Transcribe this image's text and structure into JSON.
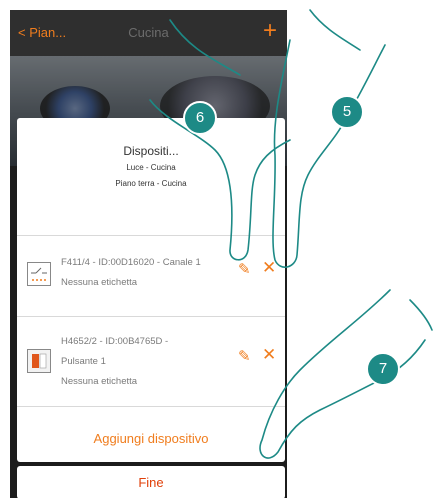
{
  "topbar": {
    "back_label": "Pian...",
    "title": "Cucina",
    "plus_icon": "+"
  },
  "card": {
    "title": "Dispositi...",
    "subtitle1": "Luce - Cucina",
    "subtitle2": "Piano terra - Cucina",
    "devices": [
      {
        "line1": "F411/4 - ID:00D16020 - Canale 1",
        "line2": "Nessuna etichetta",
        "line3": ""
      },
      {
        "line1": "H4652/2 - ID:00B4765D -",
        "line2": "Pulsante 1",
        "line3": "Nessuna etichetta"
      }
    ],
    "add_label": "Aggiungi dispositivo"
  },
  "fine_label": "Fine",
  "steps": [
    "6",
    "5",
    "7"
  ],
  "colors": {
    "accent": "#f07d1e",
    "step": "#1d8a86",
    "fine_text": "#e0400a"
  },
  "icons": {
    "edit": "pencil-icon",
    "delete": "close-icon",
    "back": "chevron-left-icon",
    "add": "plus-icon"
  }
}
